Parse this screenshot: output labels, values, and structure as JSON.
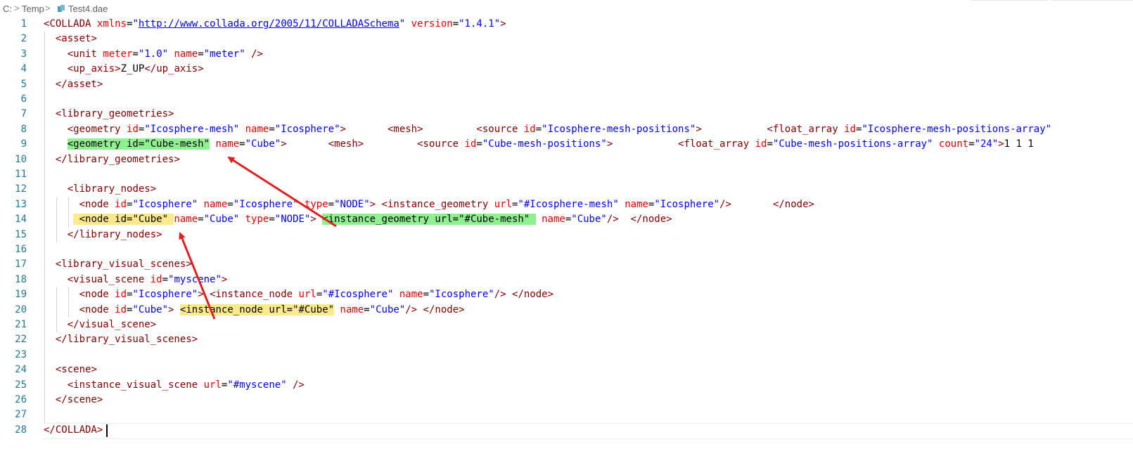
{
  "breadcrumb": {
    "drive": "C:",
    "sep": ">",
    "folder": "Temp",
    "file": "Test4.dae"
  },
  "editor": {
    "lines": [
      {
        "n": "1",
        "segs": [
          [
            "p",
            "<"
          ],
          [
            "t",
            "COLLADA"
          ],
          [
            "x",
            " "
          ],
          [
            "a",
            "xmlns"
          ],
          [
            "x",
            "="
          ],
          [
            "v",
            "\""
          ],
          [
            "link",
            "http://www.collada.org/2005/11/COLLADASchema"
          ],
          [
            "v",
            "\""
          ],
          [
            "x",
            " "
          ],
          [
            "a",
            "version"
          ],
          [
            "x",
            "="
          ],
          [
            "v",
            "\"1.4.1\""
          ],
          [
            "p",
            ">"
          ]
        ]
      },
      {
        "n": "2",
        "segs": [
          [
            "x",
            "  "
          ],
          [
            "p",
            "<"
          ],
          [
            "t",
            "asset"
          ],
          [
            "p",
            ">"
          ]
        ]
      },
      {
        "n": "3",
        "segs": [
          [
            "x",
            "    "
          ],
          [
            "p",
            "<"
          ],
          [
            "t",
            "unit"
          ],
          [
            "x",
            " "
          ],
          [
            "a",
            "meter"
          ],
          [
            "x",
            "="
          ],
          [
            "v",
            "\"1.0\""
          ],
          [
            "x",
            " "
          ],
          [
            "a",
            "name"
          ],
          [
            "x",
            "="
          ],
          [
            "v",
            "\"meter\""
          ],
          [
            "x",
            " "
          ],
          [
            "p",
            "/>"
          ]
        ]
      },
      {
        "n": "4",
        "segs": [
          [
            "x",
            "    "
          ],
          [
            "p",
            "<"
          ],
          [
            "t",
            "up_axis"
          ],
          [
            "p",
            ">"
          ],
          [
            "x",
            "Z_UP"
          ],
          [
            "p",
            "</"
          ],
          [
            "t",
            "up_axis"
          ],
          [
            "p",
            ">"
          ]
        ]
      },
      {
        "n": "5",
        "segs": [
          [
            "x",
            "  "
          ],
          [
            "p",
            "</"
          ],
          [
            "t",
            "asset"
          ],
          [
            "p",
            ">"
          ]
        ]
      },
      {
        "n": "6",
        "segs": []
      },
      {
        "n": "7",
        "segs": [
          [
            "x",
            "  "
          ],
          [
            "p",
            "<"
          ],
          [
            "t",
            "library_geometries"
          ],
          [
            "p",
            ">"
          ]
        ]
      },
      {
        "n": "8",
        "segs": [
          [
            "x",
            "    "
          ],
          [
            "p",
            "<"
          ],
          [
            "t",
            "geometry"
          ],
          [
            "x",
            " "
          ],
          [
            "a",
            "id"
          ],
          [
            "x",
            "="
          ],
          [
            "v",
            "\"Icosphere-mesh\""
          ],
          [
            "x",
            " "
          ],
          [
            "a",
            "name"
          ],
          [
            "x",
            "="
          ],
          [
            "v",
            "\"Icosphere\""
          ],
          [
            "p",
            ">"
          ],
          [
            "x",
            "       "
          ],
          [
            "p",
            "<"
          ],
          [
            "t",
            "mesh"
          ],
          [
            "p",
            ">"
          ],
          [
            "x",
            "         "
          ],
          [
            "p",
            "<"
          ],
          [
            "t",
            "source"
          ],
          [
            "x",
            " "
          ],
          [
            "a",
            "id"
          ],
          [
            "x",
            "="
          ],
          [
            "v",
            "\"Icosphere-mesh-positions\""
          ],
          [
            "p",
            ">"
          ],
          [
            "x",
            "           "
          ],
          [
            "p",
            "<"
          ],
          [
            "t",
            "float_array"
          ],
          [
            "x",
            " "
          ],
          [
            "a",
            "id"
          ],
          [
            "x",
            "="
          ],
          [
            "v",
            "\"Icosphere-mesh-positions-array\""
          ]
        ]
      },
      {
        "n": "9",
        "segs": [
          [
            "x",
            "    "
          ],
          [
            "hg",
            "<geometry id=\"Cube-mesh\""
          ],
          [
            "x",
            " "
          ],
          [
            "a",
            "name"
          ],
          [
            "x",
            "="
          ],
          [
            "v",
            "\"Cube\""
          ],
          [
            "p",
            ">"
          ],
          [
            "x",
            "       "
          ],
          [
            "p",
            "<"
          ],
          [
            "t",
            "mesh"
          ],
          [
            "p",
            ">"
          ],
          [
            "x",
            "         "
          ],
          [
            "p",
            "<"
          ],
          [
            "t",
            "source"
          ],
          [
            "x",
            " "
          ],
          [
            "a",
            "id"
          ],
          [
            "x",
            "="
          ],
          [
            "v",
            "\"Cube-mesh-positions\""
          ],
          [
            "p",
            ">"
          ],
          [
            "x",
            "           "
          ],
          [
            "p",
            "<"
          ],
          [
            "t",
            "float_array"
          ],
          [
            "x",
            " "
          ],
          [
            "a",
            "id"
          ],
          [
            "x",
            "="
          ],
          [
            "v",
            "\"Cube-mesh-positions-array\""
          ],
          [
            "x",
            " "
          ],
          [
            "a",
            "count"
          ],
          [
            "x",
            "="
          ],
          [
            "v",
            "\"24\""
          ],
          [
            "p",
            ">"
          ],
          [
            "x",
            "1 1 1"
          ]
        ]
      },
      {
        "n": "10",
        "segs": [
          [
            "x",
            "  "
          ],
          [
            "p",
            "</"
          ],
          [
            "t",
            "library_geometries"
          ],
          [
            "p",
            ">"
          ]
        ]
      },
      {
        "n": "11",
        "segs": []
      },
      {
        "n": "12",
        "segs": [
          [
            "x",
            "    "
          ],
          [
            "p",
            "<"
          ],
          [
            "t",
            "library_nodes"
          ],
          [
            "p",
            ">"
          ]
        ]
      },
      {
        "n": "13",
        "segs": [
          [
            "x",
            "      "
          ],
          [
            "p",
            "<"
          ],
          [
            "t",
            "node"
          ],
          [
            "x",
            " "
          ],
          [
            "a",
            "id"
          ],
          [
            "x",
            "="
          ],
          [
            "v",
            "\"Icosphere\""
          ],
          [
            "x",
            " "
          ],
          [
            "a",
            "name"
          ],
          [
            "x",
            "="
          ],
          [
            "v",
            "\"Icosphere\""
          ],
          [
            "x",
            " "
          ],
          [
            "a",
            "type"
          ],
          [
            "x",
            "="
          ],
          [
            "v",
            "\"NODE\""
          ],
          [
            "p",
            ">"
          ],
          [
            "x",
            " "
          ],
          [
            "p",
            "<"
          ],
          [
            "t",
            "instance_geometry"
          ],
          [
            "x",
            " "
          ],
          [
            "a",
            "url"
          ],
          [
            "x",
            "="
          ],
          [
            "v",
            "\"#Icosphere-mesh\""
          ],
          [
            "x",
            " "
          ],
          [
            "a",
            "name"
          ],
          [
            "x",
            "="
          ],
          [
            "v",
            "\"Icosphere\""
          ],
          [
            "p",
            "/>"
          ],
          [
            "x",
            "       "
          ],
          [
            "p",
            "</"
          ],
          [
            "t",
            "node"
          ],
          [
            "p",
            ">"
          ]
        ]
      },
      {
        "n": "14",
        "segs": [
          [
            "x",
            "     "
          ],
          [
            "hy",
            " <node id=\"Cube\" "
          ],
          [
            "a",
            "name"
          ],
          [
            "x",
            "="
          ],
          [
            "v",
            "\"Cube\""
          ],
          [
            "x",
            " "
          ],
          [
            "a",
            "type"
          ],
          [
            "x",
            "="
          ],
          [
            "v",
            "\"NODE\""
          ],
          [
            "p",
            ">"
          ],
          [
            "x",
            " "
          ],
          [
            "hg",
            "<instance_geometry url=\"#Cube-mesh\" "
          ],
          [
            "x",
            " "
          ],
          [
            "a",
            "name"
          ],
          [
            "x",
            "="
          ],
          [
            "v",
            "\"Cube\""
          ],
          [
            "p",
            "/>"
          ],
          [
            "x",
            "  "
          ],
          [
            "p",
            "</"
          ],
          [
            "t",
            "node"
          ],
          [
            "p",
            ">"
          ]
        ]
      },
      {
        "n": "15",
        "segs": [
          [
            "x",
            "    "
          ],
          [
            "p",
            "</"
          ],
          [
            "t",
            "library_nodes"
          ],
          [
            "p",
            ">"
          ]
        ]
      },
      {
        "n": "16",
        "segs": []
      },
      {
        "n": "17",
        "segs": [
          [
            "x",
            "  "
          ],
          [
            "p",
            "<"
          ],
          [
            "t",
            "library_visual_scenes"
          ],
          [
            "p",
            ">"
          ]
        ]
      },
      {
        "n": "18",
        "segs": [
          [
            "x",
            "    "
          ],
          [
            "p",
            "<"
          ],
          [
            "t",
            "visual_scene"
          ],
          [
            "x",
            " "
          ],
          [
            "a",
            "id"
          ],
          [
            "x",
            "="
          ],
          [
            "v",
            "\"myscene\""
          ],
          [
            "p",
            ">"
          ]
        ]
      },
      {
        "n": "19",
        "segs": [
          [
            "x",
            "      "
          ],
          [
            "p",
            "<"
          ],
          [
            "t",
            "node"
          ],
          [
            "x",
            " "
          ],
          [
            "a",
            "id"
          ],
          [
            "x",
            "="
          ],
          [
            "v",
            "\"Icosphere\""
          ],
          [
            "p",
            ">"
          ],
          [
            "x",
            " "
          ],
          [
            "p",
            "<"
          ],
          [
            "t",
            "instance_node"
          ],
          [
            "x",
            " "
          ],
          [
            "a",
            "url"
          ],
          [
            "x",
            "="
          ],
          [
            "v",
            "\"#Icosphere\""
          ],
          [
            "x",
            " "
          ],
          [
            "a",
            "name"
          ],
          [
            "x",
            "="
          ],
          [
            "v",
            "\"Icosphere\""
          ],
          [
            "p",
            "/>"
          ],
          [
            "x",
            " "
          ],
          [
            "p",
            "</"
          ],
          [
            "t",
            "node"
          ],
          [
            "p",
            ">"
          ]
        ]
      },
      {
        "n": "20",
        "segs": [
          [
            "x",
            "      "
          ],
          [
            "p",
            "<"
          ],
          [
            "t",
            "node"
          ],
          [
            "x",
            " "
          ],
          [
            "a",
            "id"
          ],
          [
            "x",
            "="
          ],
          [
            "v",
            "\"Cube\""
          ],
          [
            "p",
            ">"
          ],
          [
            "x",
            " "
          ],
          [
            "hy",
            "<instance_node url=\"#Cube\""
          ],
          [
            "x",
            " "
          ],
          [
            "a",
            "name"
          ],
          [
            "x",
            "="
          ],
          [
            "v",
            "\"Cube\""
          ],
          [
            "p",
            "/>"
          ],
          [
            "x",
            " "
          ],
          [
            "p",
            "</"
          ],
          [
            "t",
            "node"
          ],
          [
            "p",
            ">"
          ]
        ]
      },
      {
        "n": "21",
        "segs": [
          [
            "x",
            "    "
          ],
          [
            "p",
            "</"
          ],
          [
            "t",
            "visual_scene"
          ],
          [
            "p",
            ">"
          ]
        ]
      },
      {
        "n": "22",
        "segs": [
          [
            "x",
            "  "
          ],
          [
            "p",
            "</"
          ],
          [
            "t",
            "library_visual_scenes"
          ],
          [
            "p",
            ">"
          ]
        ]
      },
      {
        "n": "23",
        "segs": []
      },
      {
        "n": "24",
        "segs": [
          [
            "x",
            "  "
          ],
          [
            "p",
            "<"
          ],
          [
            "t",
            "scene"
          ],
          [
            "p",
            ">"
          ]
        ]
      },
      {
        "n": "25",
        "segs": [
          [
            "x",
            "    "
          ],
          [
            "p",
            "<"
          ],
          [
            "t",
            "instance_visual_scene"
          ],
          [
            "x",
            " "
          ],
          [
            "a",
            "url"
          ],
          [
            "x",
            "="
          ],
          [
            "v",
            "\"#myscene\""
          ],
          [
            "x",
            " "
          ],
          [
            "p",
            "/>"
          ]
        ]
      },
      {
        "n": "26",
        "segs": [
          [
            "x",
            "  "
          ],
          [
            "p",
            "</"
          ],
          [
            "t",
            "scene"
          ],
          [
            "p",
            ">"
          ]
        ]
      },
      {
        "n": "27",
        "segs": []
      },
      {
        "n": "28",
        "segs": [
          [
            "p",
            "</"
          ],
          [
            "t",
            "COLLADA"
          ],
          [
            "p",
            ">"
          ]
        ]
      }
    ]
  }
}
